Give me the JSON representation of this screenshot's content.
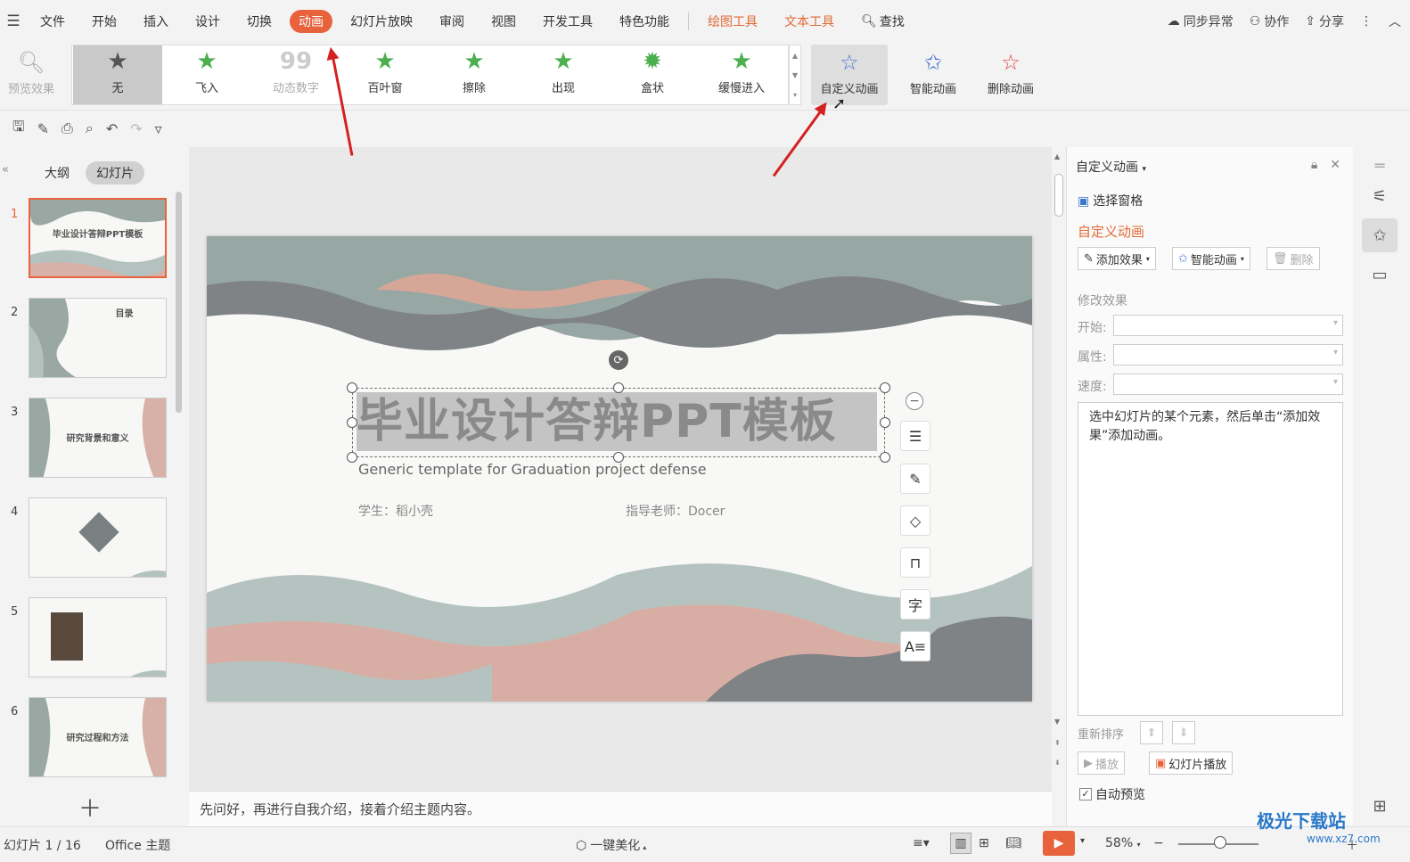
{
  "menubar": {
    "file": "文件",
    "tabs": [
      "开始",
      "插入",
      "设计",
      "切换",
      "动画",
      "幻灯片放映",
      "审阅",
      "视图",
      "开发工具",
      "特色功能"
    ],
    "context_tabs": [
      "绘图工具",
      "文本工具"
    ],
    "search": "查找",
    "sync": "同步异常",
    "collab": "协作",
    "share": "分享"
  },
  "ribbon": {
    "preview": "预览效果",
    "effects": [
      "无",
      "飞入",
      "动态数字",
      "百叶窗",
      "擦除",
      "出现",
      "盒状",
      "缓慢进入"
    ],
    "custom_anim": "自定义动画",
    "smart_anim": "智能动画",
    "delete_anim": "删除动画"
  },
  "panel": {
    "tab_outline": "大纲",
    "tab_slides": "幻灯片",
    "slides": [
      {
        "num": "1",
        "title": "毕业设计答辩PPT模板"
      },
      {
        "num": "2",
        "title": "目录"
      },
      {
        "num": "3",
        "title": "研究背景和意义"
      },
      {
        "num": "4",
        "title": ""
      },
      {
        "num": "5",
        "title": ""
      },
      {
        "num": "6",
        "title": "研究过程和方法"
      }
    ]
  },
  "slide": {
    "title": "毕业设计答辩PPT模板",
    "subtitle": "Generic template for Graduation project defense",
    "student": "学生：稻小壳",
    "teacher": "指导老师：Docer"
  },
  "notes": "先问好，再进行自我介绍，接着介绍主题内容。",
  "rightpane": {
    "title": "自定义动画",
    "select_pane": "选择窗格",
    "heading": "自定义动画",
    "add_effect": "添加效果",
    "smart_anim": "智能动画",
    "delete": "删除",
    "modify": "修改效果",
    "start": "开始:",
    "property": "属性:",
    "speed": "速度:",
    "hint": "选中幻灯片的某个元素，然后单击“添加效果”添加动画。",
    "reorder": "重新排序",
    "play": "播放",
    "slideshow": "幻灯片播放",
    "auto_preview": "自动预览"
  },
  "statusbar": {
    "slide_info": "幻灯片 1 / 16",
    "theme": "Office 主题",
    "beautify": "一键美化",
    "zoom": "58%"
  },
  "watermark": {
    "name": "极光下载站",
    "url": "www.xz7.com"
  },
  "colors": {
    "accent": "#e8623c",
    "context": "#e26a36",
    "star": "#4caf50",
    "arrow": "#d42020"
  }
}
